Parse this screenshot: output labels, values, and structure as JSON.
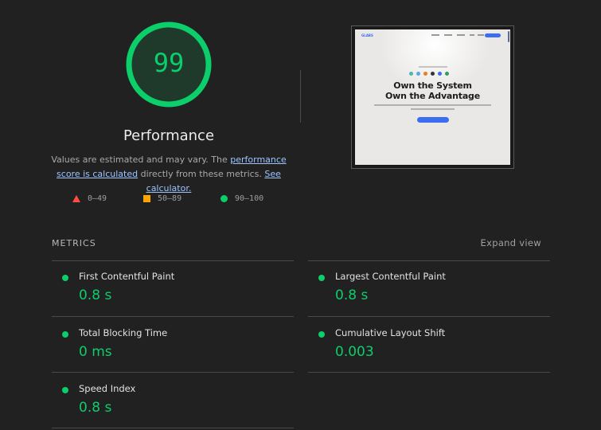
{
  "summary": {
    "score": "99",
    "score_fraction": 0.99,
    "title": "Performance",
    "desc_prefix": "Values are estimated and may vary. The ",
    "desc_link1": "performance score is calculated",
    "desc_middle": " directly from these metrics. ",
    "desc_link2": "See calculator."
  },
  "legend": {
    "fail": "0–49",
    "average": "50–89",
    "pass": "90–100"
  },
  "thumbnail": {
    "logo": "GLABS",
    "headline_line1": "Own the System",
    "headline_line2": "Own the Advantage"
  },
  "metrics_section": {
    "label": "METRICS",
    "expand_label": "Expand view",
    "items": [
      {
        "name": "First Contentful Paint",
        "value": "0.8 s"
      },
      {
        "name": "Largest Contentful Paint",
        "value": "0.8 s"
      },
      {
        "name": "Total Blocking Time",
        "value": "0 ms"
      },
      {
        "name": "Cumulative Layout Shift",
        "value": "0.003"
      },
      {
        "name": "Speed Index",
        "value": "0.8 s"
      }
    ]
  },
  "colors": {
    "pass": "#0cce6b",
    "average": "#ffa400",
    "fail": "#ff4e42",
    "link": "#9dc5ff",
    "background": "#212121"
  }
}
